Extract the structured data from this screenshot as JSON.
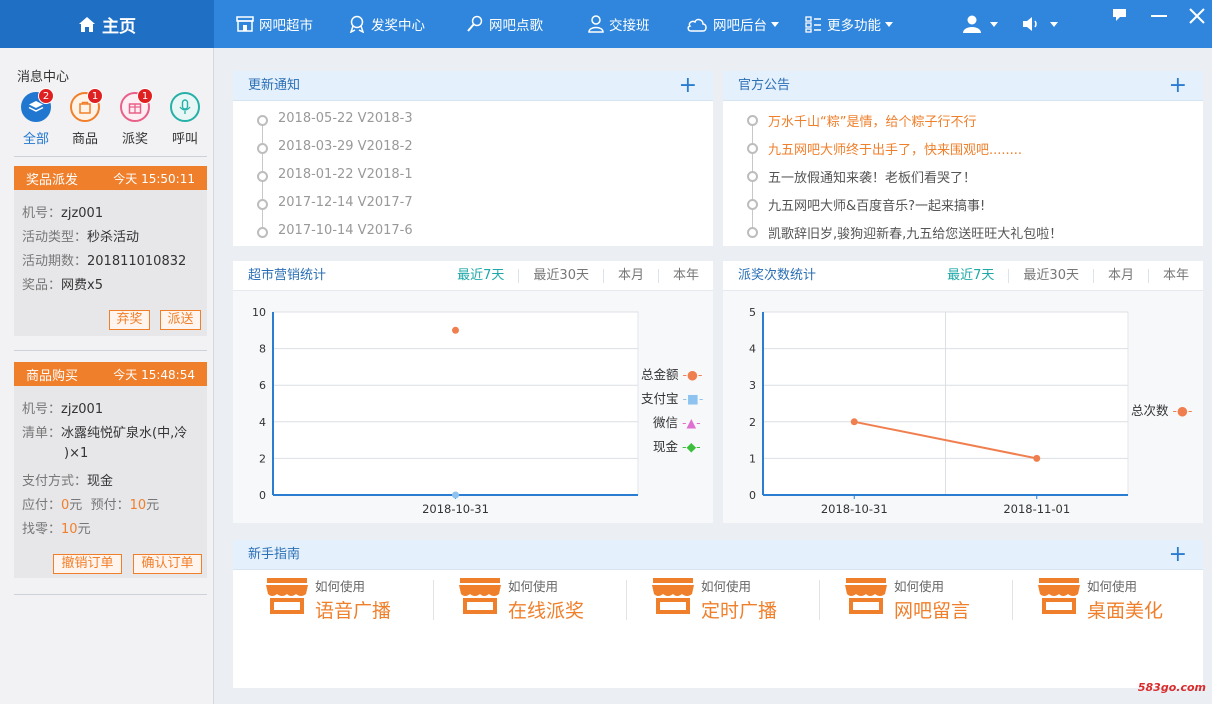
{
  "topbar": {
    "home_label": "主页",
    "nav": [
      {
        "label": "网吧超市",
        "icon": "store-icon",
        "dropdown": false
      },
      {
        "label": "发奖中心",
        "icon": "award-icon",
        "dropdown": false
      },
      {
        "label": "网吧点歌",
        "icon": "microphone-icon",
        "dropdown": false
      },
      {
        "label": "交接班",
        "icon": "user-icon",
        "dropdown": false
      },
      {
        "label": "网吧后台",
        "icon": "cloud-icon",
        "dropdown": true
      },
      {
        "label": "更多功能",
        "icon": "grid-list-icon",
        "dropdown": true
      }
    ]
  },
  "sidebar": {
    "title": "消息中心",
    "categories": [
      {
        "label": "全部",
        "badge": "2",
        "icon": "layers-icon",
        "color": "#2177cf",
        "active": true
      },
      {
        "label": "商品",
        "badge": "1",
        "icon": "bag-icon",
        "color": "#f07f2b",
        "active": false
      },
      {
        "label": "派奖",
        "badge": "1",
        "icon": "gift-icon",
        "color": "#e8608a",
        "active": false
      },
      {
        "label": "呼叫",
        "badge": "",
        "icon": "mic-icon",
        "color": "#27b0a8",
        "active": false
      }
    ],
    "prize_card": {
      "title": "奖品派发",
      "time": "今天 15:50:11",
      "rows": [
        {
          "k": "机号：",
          "v": "zjz001"
        },
        {
          "k": "活动类型：",
          "v": "秒杀活动"
        },
        {
          "k": "活动期数：",
          "v": "201811010832"
        },
        {
          "k": "奖品：",
          "v": "网费x5"
        }
      ],
      "btn_abandon": "弃奖",
      "btn_send": "派送"
    },
    "order_card": {
      "title": "商品购买",
      "time": "今天 15:48:54",
      "machine_k": "机号：",
      "machine_v": "zjz001",
      "list_k": "清单：",
      "list_v1": "冰露纯悦矿泉水(中,冷",
      "list_v2": ")×1",
      "pay_k": "支付方式：",
      "pay_v": "现金",
      "due_k": "应付：",
      "due_v": "0",
      "unit1": "元",
      "prepay_k": "预付：",
      "prepay_v": "10",
      "unit2": "元",
      "change_k": "找零：",
      "change_v": "10",
      "unit3": "元",
      "btn_cancel": "撤销订单",
      "btn_confirm": "确认订单"
    }
  },
  "updates": {
    "title": "更新通知",
    "items": [
      "2018-05-22 V2018-3",
      "2018-03-29 V2018-2",
      "2018-01-22 V2018-1",
      "2017-12-14 V2017-7",
      "2017-10-14 V2017-6"
    ]
  },
  "notices": {
    "title": "官方公告",
    "items": [
      {
        "text": "万水千山“粽”是情，给个粽子行不行",
        "color": "#f07f2b"
      },
      {
        "text": "九五网吧大师终于出手了，快来围观吧........",
        "color": "#f07f2b"
      },
      {
        "text": "五一放假通知来袭！老板们看哭了！",
        "color": "#555555"
      },
      {
        "text": "九五网吧大师&百度音乐?一起来搞事!",
        "color": "#555555"
      },
      {
        "text": "凯歌辞旧岁,骏狗迎新春,九五给您送旺旺大礼包啦！",
        "color": "#555555"
      }
    ]
  },
  "market_stats": {
    "title": "超市营销统计",
    "tabs": [
      "最近7天",
      "最近30天",
      "本月",
      "本年"
    ]
  },
  "prize_stats": {
    "title": "派奖次数统计",
    "tabs": [
      "最近7天",
      "最近30天",
      "本月",
      "本年"
    ]
  },
  "chart_data": [
    {
      "type": "scatter",
      "x": [
        "2018-10-31"
      ],
      "yticks": [
        "0",
        "2",
        "4",
        "6",
        "8",
        "10"
      ],
      "ylim": [
        0,
        10
      ],
      "grid": true,
      "legend_position": "right",
      "series": [
        {
          "name": "总金额",
          "values": [
            9
          ],
          "color": "#f07f50"
        },
        {
          "name": "支付宝",
          "values": [
            0
          ],
          "color": "#8ec3f0"
        },
        {
          "name": "微信",
          "values": [
            null
          ],
          "color": "#e070d0"
        },
        {
          "name": "现金",
          "values": [
            null
          ],
          "color": "#3cbf3c"
        }
      ]
    },
    {
      "type": "line",
      "x": [
        "2018-10-31",
        "2018-11-01"
      ],
      "yticks": [
        "0",
        "1",
        "2",
        "3",
        "4",
        "5"
      ],
      "ylim": [
        0,
        5
      ],
      "grid": true,
      "legend_position": "right",
      "series": [
        {
          "name": "总次数",
          "values": [
            2,
            1
          ],
          "color": "#f07f50"
        }
      ]
    }
  ],
  "guide": {
    "title": "新手指南",
    "items": [
      {
        "small": "如何使用",
        "big": "语音广播"
      },
      {
        "small": "如何使用",
        "big": "在线派奖"
      },
      {
        "small": "如何使用",
        "big": "定时广播"
      },
      {
        "small": "如何使用",
        "big": "网吧留言"
      },
      {
        "small": "如何使用",
        "big": "桌面美化"
      }
    ]
  },
  "watermark": "583go.com"
}
